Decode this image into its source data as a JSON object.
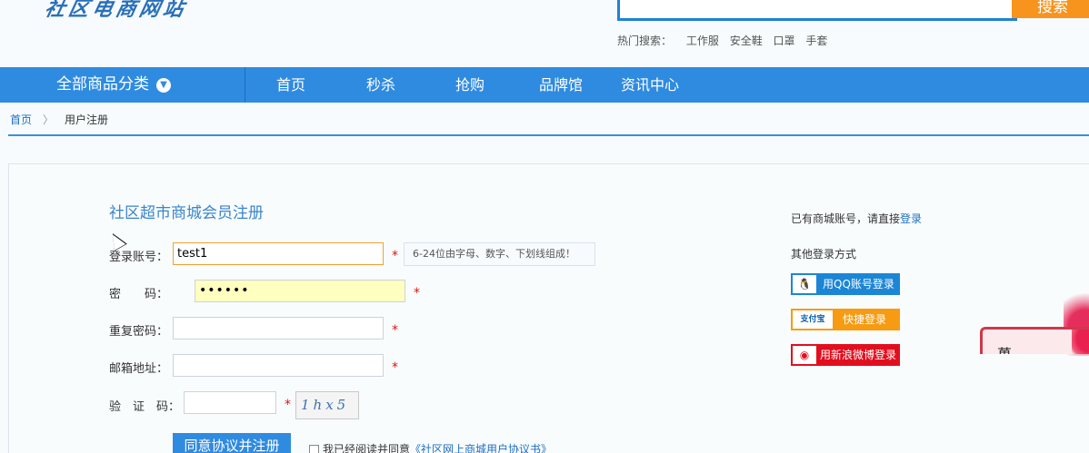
{
  "header": {
    "logo_text": "社区电商网站",
    "search_button": "搜索",
    "hot_label": "热门搜索：",
    "hot_terms": [
      "工作服",
      "安全鞋",
      "口罩",
      "手套"
    ]
  },
  "nav": {
    "all_categories": "全部商品分类",
    "items": [
      "首页",
      "秒杀",
      "抢购",
      "品牌馆",
      "资讯中心"
    ]
  },
  "breadcrumb": {
    "home": "首页",
    "separator": "〉",
    "current": "用户注册"
  },
  "form": {
    "title": "社区超市商城会员注册",
    "account_label": "登录账号：",
    "account_value": "test1",
    "account_hint": "6-24位由字母、数字、下划线组成！",
    "password_label": "密　　码：",
    "password_value": "••••••",
    "confirm_label": "重复密码：",
    "email_label": "邮箱地址：",
    "captcha_label": "验　证　码：",
    "captcha_text": "1hx5",
    "required_mark": "*",
    "submit_label": "同意协议并注册",
    "agree_text": "我已经阅读并同意",
    "agree_link": "《社区网上商城用户协议书》"
  },
  "side": {
    "have_account": "已有商城账号，请直接",
    "login_link": "登录",
    "other_login": "其他登录方式",
    "qq_icon": "qq-penguin-icon",
    "qq_label": "用QQ账号登录",
    "alipay_icon": "alipay-logo-icon",
    "alipay_icon_text": "支付宝",
    "alipay_label": "快捷登录",
    "weibo_icon": "weibo-icon",
    "weibo_label": "用新浪微博登录"
  },
  "promo": {
    "text": "萬"
  },
  "colors": {
    "nav_blue": "#2f8be0",
    "search_orange": "#f7941d",
    "required_red": "#e01010",
    "link_blue": "#1e6fbf"
  }
}
